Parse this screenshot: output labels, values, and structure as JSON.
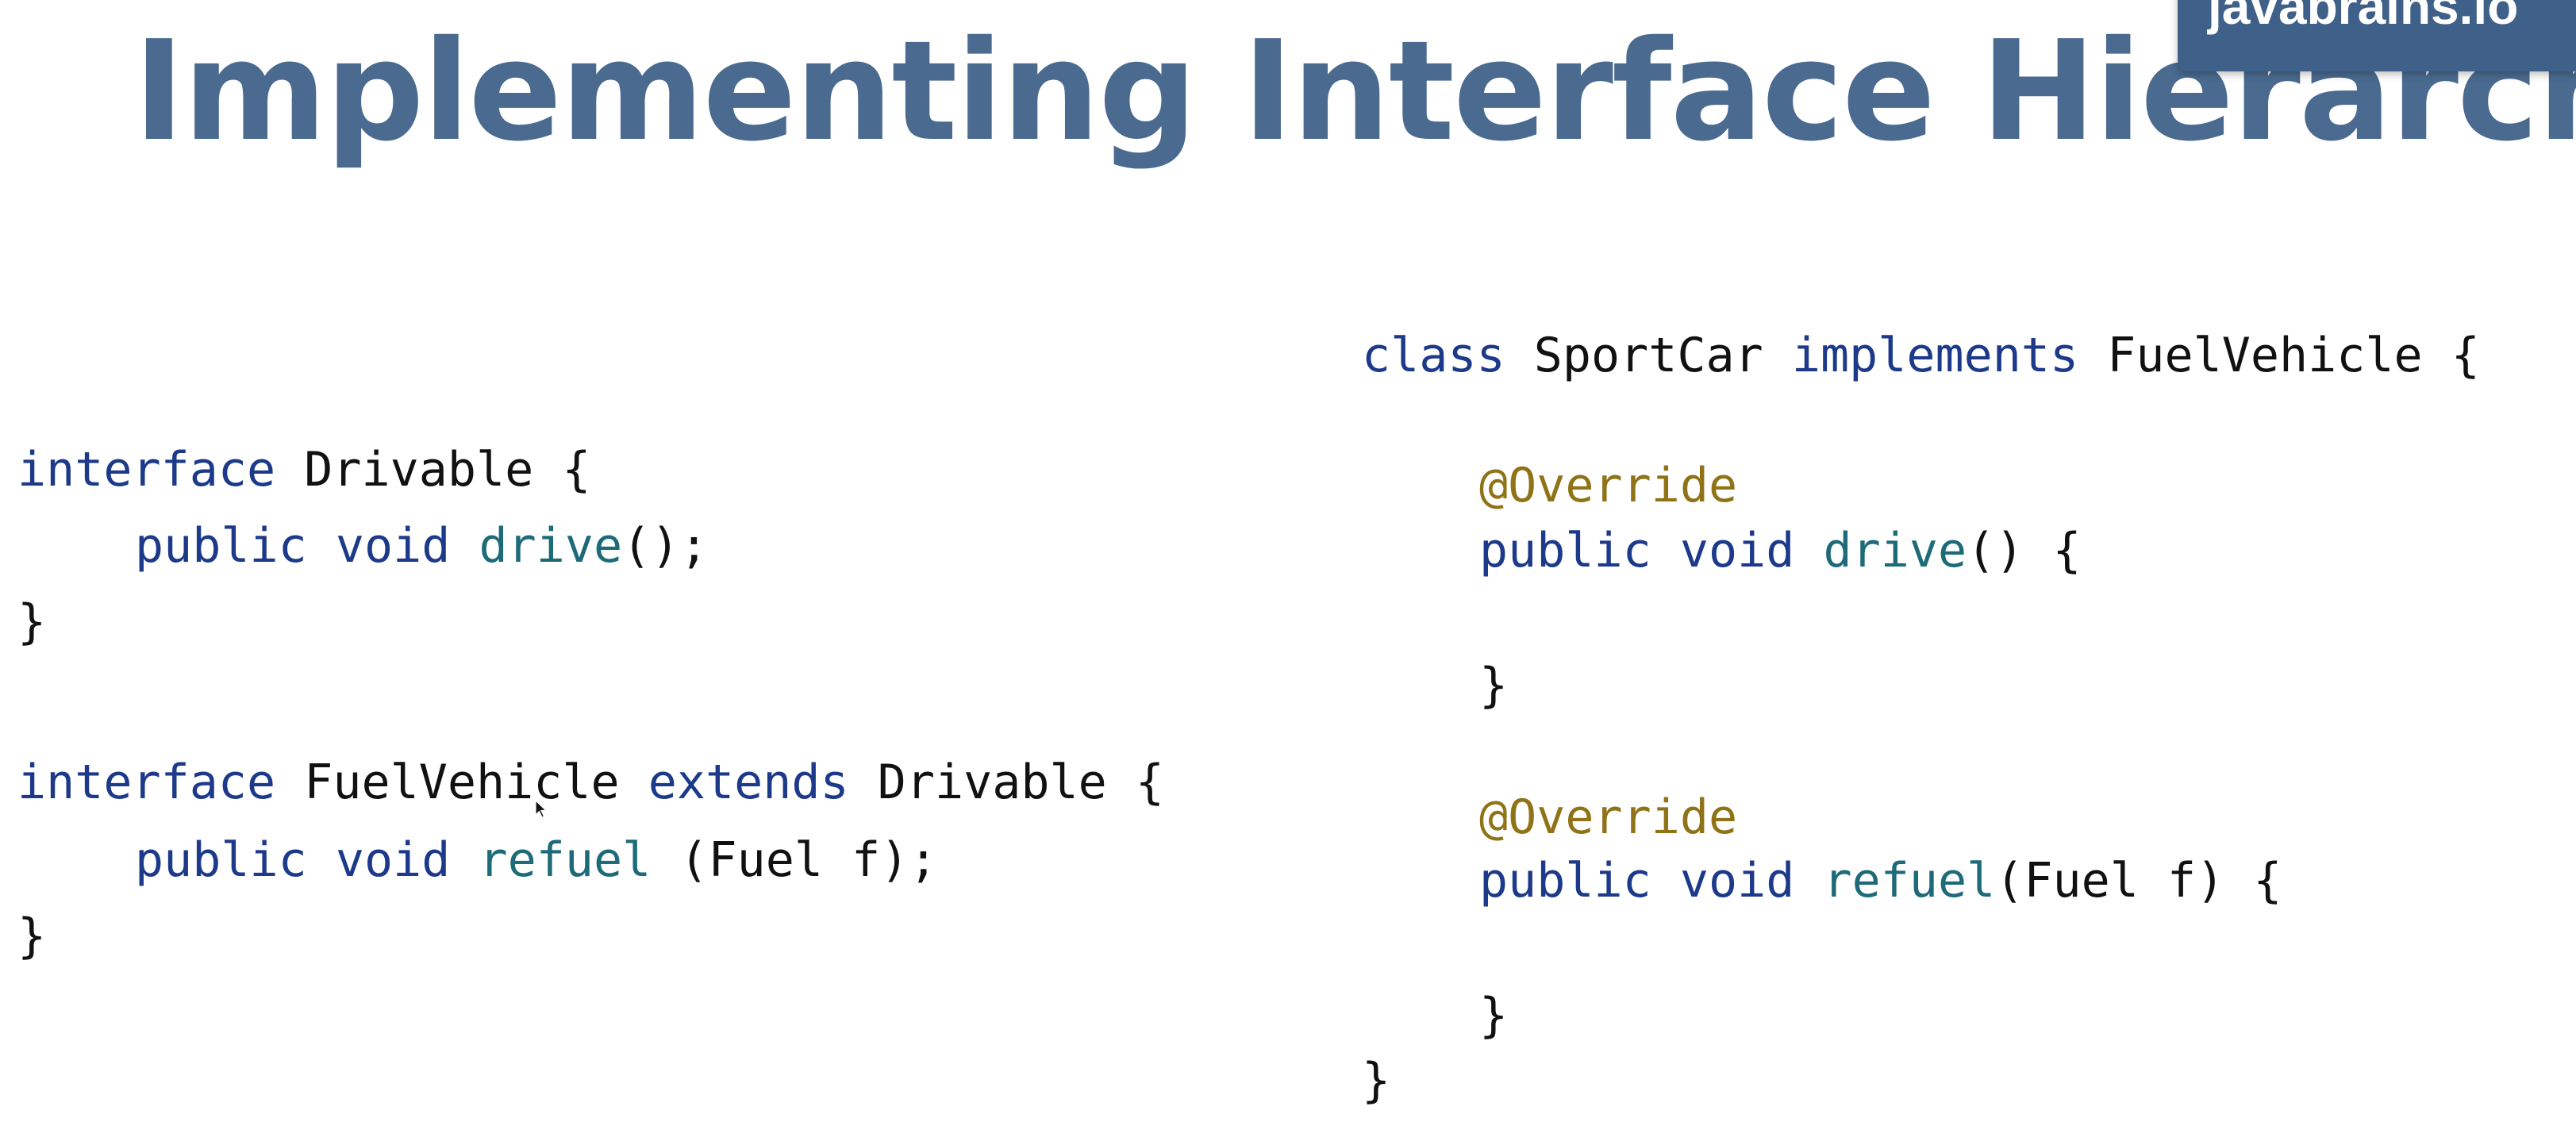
{
  "slide": {
    "title": "Implementing Interface Hierarchies",
    "brand": "javabrains.io"
  },
  "code_left": {
    "l1": {
      "kw": "interface",
      "rest": " Drivable {"
    },
    "l2": {
      "kw": "public void",
      "fn": "drive",
      "rest": "();"
    },
    "l3": {
      "text": "}"
    },
    "l4": {
      "kw1": "interface",
      "name": " FuelVehicle ",
      "kw2": "extends",
      "rest": " Drivable {"
    },
    "l5": {
      "kw": "public void",
      "fn": "refuel",
      "rest": " (Fuel f);"
    },
    "l6": {
      "text": "}"
    }
  },
  "code_right": {
    "l1": {
      "kw1": "class",
      "name": " SportCar ",
      "kw2": "implements",
      "rest": " FuelVehicle {"
    },
    "l2": {
      "an": "@Override"
    },
    "l3": {
      "kw": "public void",
      "fn": "drive",
      "rest": "() {"
    },
    "l4": {
      "text": "}"
    },
    "l5": {
      "an": "@Override"
    },
    "l6": {
      "kw": "public void",
      "fn": "refuel",
      "rest": "(Fuel f) {"
    },
    "l7": {
      "text": "}"
    },
    "l8": {
      "text": "}"
    }
  },
  "colors": {
    "title": "#4a6a90",
    "brand_badge": "#3f6189",
    "keyword": "#1d3a8a",
    "method": "#1d6a78",
    "annotation": "#8f7316"
  }
}
